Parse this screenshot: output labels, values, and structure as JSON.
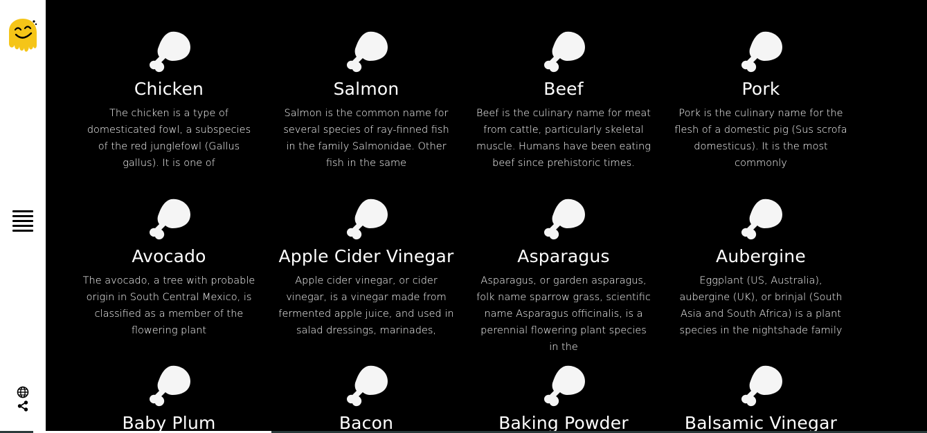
{
  "sidebar": {
    "logo_icon": "smiling-face-logo",
    "menu_icon": "hamburger-menu-icon",
    "globe_icon": "globe-icon",
    "share_icon": "share-icon"
  },
  "colors": {
    "background": "#000000",
    "sidebar": "#ffffff",
    "text": "#ffffff",
    "logo": "#f5c518"
  },
  "items": [
    {
      "title": "Chicken",
      "desc": "The chicken is a type of domesticated fowl, a subspecies of the red junglefowl (Gallus gallus). It is one of"
    },
    {
      "title": "Salmon",
      "desc": "Salmon is the common name for several species of ray-finned fish in the family Salmonidae. Other fish in the same"
    },
    {
      "title": "Beef",
      "desc": "Beef is the culinary name for meat from cattle, particularly skeletal muscle. Humans have been eating beef since prehistoric times."
    },
    {
      "title": "Pork",
      "desc": "Pork is the culinary name for the flesh of a domestic pig (Sus scrofa domesticus). It is the most commonly"
    },
    {
      "title": "Avocado",
      "desc": "The avocado, a tree with probable origin in South Central Mexico, is classified as a member of the flowering plant"
    },
    {
      "title": "Apple Cider Vinegar",
      "desc": "Apple cider vinegar, or cider vinegar, is a vinegar made from fermented apple juice, and used in salad dressings, marinades,"
    },
    {
      "title": "Asparagus",
      "desc": "Asparagus, or garden asparagus, folk name sparrow grass, scientific name Asparagus officinalis, is a perennial flowering plant species in the"
    },
    {
      "title": "Aubergine",
      "desc": "Eggplant (US, Australia), aubergine (UK), or brinjal (South Asia and South Africa) is a plant species in the nightshade family"
    },
    {
      "title": "Baby Plum",
      "desc": ""
    },
    {
      "title": "Bacon",
      "desc": ""
    },
    {
      "title": "Baking Powder",
      "desc": ""
    },
    {
      "title": "Balsamic Vinegar",
      "desc": ""
    }
  ],
  "card_icon": "drumstick-icon"
}
